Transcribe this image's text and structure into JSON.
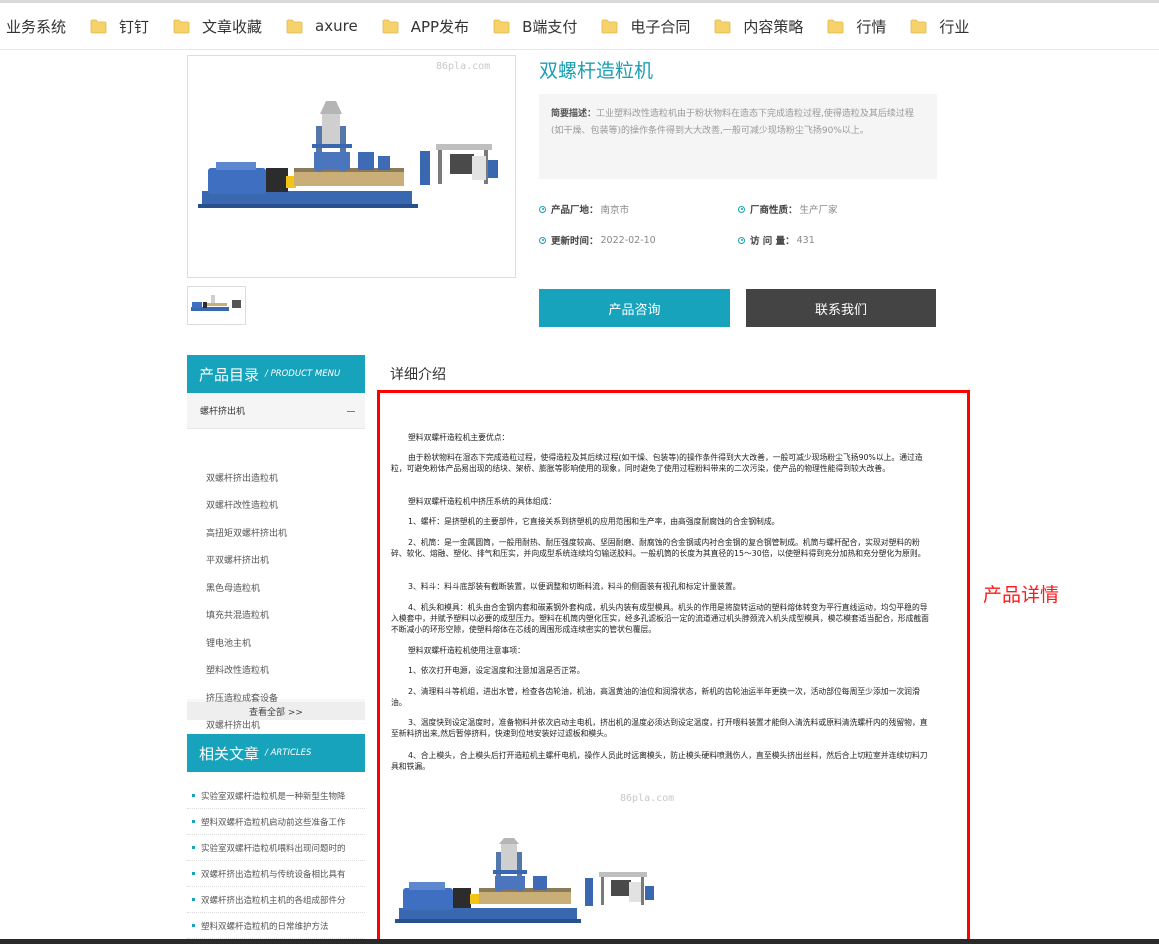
{
  "bookmarks": [
    {
      "label": "业务系统",
      "folder": false
    },
    {
      "label": "钉钉",
      "folder": true
    },
    {
      "label": "文章收藏",
      "folder": true
    },
    {
      "label": "axure",
      "folder": true
    },
    {
      "label": "APP发布",
      "folder": true
    },
    {
      "label": "B端支付",
      "folder": true
    },
    {
      "label": "电子合同",
      "folder": true
    },
    {
      "label": "内容策略",
      "folder": true
    },
    {
      "label": "行情",
      "folder": true
    },
    {
      "label": "行业",
      "folder": true
    }
  ],
  "product": {
    "title": "双螺杆造粒机",
    "watermark": "86pla.com",
    "desc_label": "简要描述：",
    "desc": "工业塑料改性造粒机由于粉状物料在造态下完成造粒过程,使得造粒及其后续过程(如干燥、包装等)的操作条件得到大大改善,一般可减少现场粉尘飞扬90%以上。",
    "origin_label": "产品厂地：",
    "origin": "南京市",
    "nature_label": "厂商性质：",
    "nature": "生产厂家",
    "updated_label": "更新时间：",
    "updated": "2022-02-10",
    "visits_label": "访 问 量：",
    "visits": "431",
    "consult_button": "产品咨询",
    "contact_button": "联系我们"
  },
  "sidebar": {
    "menu_title": "产品目录",
    "menu_title_en": "/ PRODUCT MENU",
    "category": "螺杆挤出机",
    "items": [
      "双螺杆挤出造粒机",
      "双螺杆改性造粒机",
      "高扭矩双螺杆挤出机",
      "平双螺杆挤出机",
      "黑色母造粒机",
      "填充共混造粒机",
      "锂电池主机",
      "塑料改性造粒机",
      "挤压造粒成套设备",
      "双螺杆挤出机"
    ],
    "view_all": "查看全部 >>",
    "articles_title": "相关文章",
    "articles_title_en": "/ ARTICLES",
    "articles": [
      "实验室双螺杆造粒机是一种新型生物降",
      "塑料双螺杆造粒机启动前这些准备工作",
      "实验室双螺杆造粒机喂料出现问题时的",
      "双螺杆挤出造粒机与传统设备相比具有",
      "双螺杆挤出造粒机主机的各组成部件分",
      "塑料双螺杆造粒机的日常维护方法"
    ]
  },
  "detail": {
    "heading": "详细介绍",
    "annotation": "产品详情",
    "paragraphs": [
      "塑料双螺杆造粒机主要优点：",
      "由于粉状物料在湿态下完成造粒过程，使得造粒及其后续过程(如干燥、包装等)的操作条件得到大大改善，一般可减少现场粉尘飞扬90%以上。通过造粒，可避免粉体产品易出现的结块、架桥、膨胀等影响使用的现象，同时避免了使用过程粉料带来的二次污染，使产品的物理性能得到较大改善。",
      "塑料双螺杆造粒机中挤压系统的具体组成：",
      "1、螺杆：是挤塑机的主要部件，它直接关系到挤塑机的应用范围和生产率，由高强度耐腐蚀的合金钢制成。",
      "2、机筒：是一金属圆筒，一般用耐热、耐压强度较高、坚固耐磨、耐腐蚀的合金钢或内衬合金钢的复合钢管制成。机筒与螺杆配合，实现对塑料的粉碎、软化、熔融、塑化、排气和压实，并向成型系统连续均匀输送胶料。一般机筒的长度为其直径的15～30倍，以使塑料得到充分加热和充分塑化为原则。",
      "3、料斗：料斗底部装有截断装置，以便调整和切断料流，料斗的侧面装有视孔和标定计量装置。",
      "4、机头和模具：机头由合金钢内套和碳素钢外套构成，机头内装有成型模具。机头的作用是将旋转运动的塑料熔体转变为平行直线运动，均匀平稳的导入模套中，并赋予塑料以必要的成型压力。塑料在机筒内塑化压实，经多孔滤板沿一定的流道通过机头脖颈流入机头成型模具，模芯模套适当配合，形成截面不断减小的环形空隙，使塑料熔体在芯线的周围形成连续密实的管状包覆层。",
      "塑料双螺杆造粒机使用注意事项：",
      "1、依次打开电源，设定温度和注意加温是否正常。",
      "2、清理料斗等机组，进出水管，检查各齿轮油，机油，高温黄油的油位和润滑状态，新机的齿轮油运半年更换一次，活动部位每周至少添加一次润滑油。",
      "3、温度快到设定温度时，准备物料并依次启动主电机，挤出机的温度必须达到设定温度，打开喂料装置才能倒入清洗料或原料清洗螺杆内的残留物，直至新料挤出来,然后暂停挤料，快速到位地安装好过滤板和模头。",
      "4、合上模头，合上模头后打开造粒机主螺杆电机，操作人员此时远离模头，防止模头硬料喷溅伤人，直至模头挤出丝料，然后合上切粒室并连续切料刀具和铁漏。"
    ],
    "watermark": "86pla.com"
  }
}
